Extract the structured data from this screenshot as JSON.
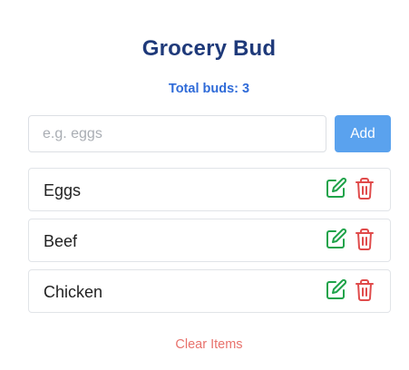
{
  "app": {
    "title": "Grocery Bud",
    "total_label": "Total buds: 3"
  },
  "form": {
    "input_value": "",
    "input_placeholder": "e.g. eggs",
    "add_label": "Add"
  },
  "items": [
    {
      "label": "Eggs",
      "edit_icon": "edit-icon",
      "delete_icon": "trash-icon"
    },
    {
      "label": "Beef",
      "edit_icon": "edit-icon",
      "delete_icon": "trash-icon"
    },
    {
      "label": "Chicken",
      "edit_icon": "edit-icon",
      "delete_icon": "trash-icon"
    }
  ],
  "footer": {
    "clear_label": "Clear Items"
  },
  "colors": {
    "title": "#1f3a7a",
    "total": "#2f6bd8",
    "add_button": "#5aa2ee",
    "edit_icon": "#1fa34a",
    "delete_icon": "#e04b4b",
    "clear_text": "#e8726c"
  }
}
